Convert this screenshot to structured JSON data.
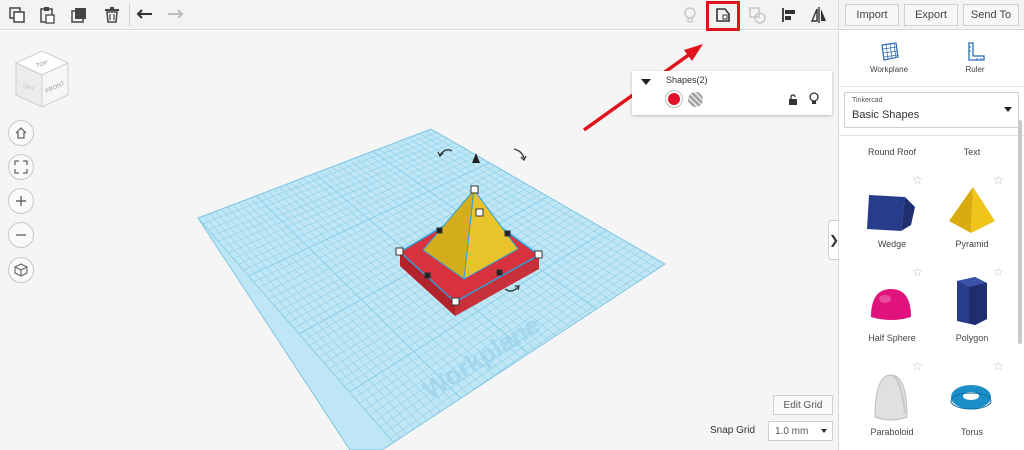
{
  "toolbar": {
    "left_icons": [
      "copy-icon",
      "paste-icon",
      "duplicate-icon",
      "delete-icon",
      "undo-icon",
      "redo-icon"
    ],
    "right_icons": [
      "lightbulb-icon",
      "group-icon",
      "ungroup-icon",
      "align-icon",
      "mirror-icon"
    ],
    "highlight_color": "#e0121b"
  },
  "header": {
    "import_label": "Import",
    "export_label": "Export",
    "send_to_label": "Send To"
  },
  "view_cube": {
    "top": "TOP",
    "front": "FRONT",
    "left": "LEFT"
  },
  "nav_icons": [
    "home-view-icon",
    "fit-view-icon",
    "zoom-in-icon",
    "zoom-out-icon",
    "perspective-icon"
  ],
  "shapes_panel": {
    "title": "Shapes(2)",
    "solid_color": "#e0102b",
    "hole_icon": "hole-stripes-icon"
  },
  "workplane": {
    "label": "Workplane",
    "grid_color": "#9fd6ec"
  },
  "sidebar": {
    "workplane_label": "Workplane",
    "ruler_label": "Ruler",
    "library_small": "Tinkercad",
    "library_name": "Basic Shapes",
    "top_labels": [
      "Round Roof",
      "Text"
    ],
    "shapes": [
      {
        "label": "Wedge",
        "color": "#283c8c"
      },
      {
        "label": "Pyramid",
        "color": "#f0c419"
      },
      {
        "label": "Half Sphere",
        "color": "#e0127c"
      },
      {
        "label": "Polygon",
        "color": "#283c8c"
      },
      {
        "label": "Paraboloid",
        "color": "#e6e6e6"
      },
      {
        "label": "Torus",
        "color": "#1b8ec8"
      }
    ]
  },
  "bottom": {
    "edit_grid_label": "Edit Grid",
    "snap_grid_label": "Snap Grid",
    "snap_value": "1.0 mm"
  }
}
